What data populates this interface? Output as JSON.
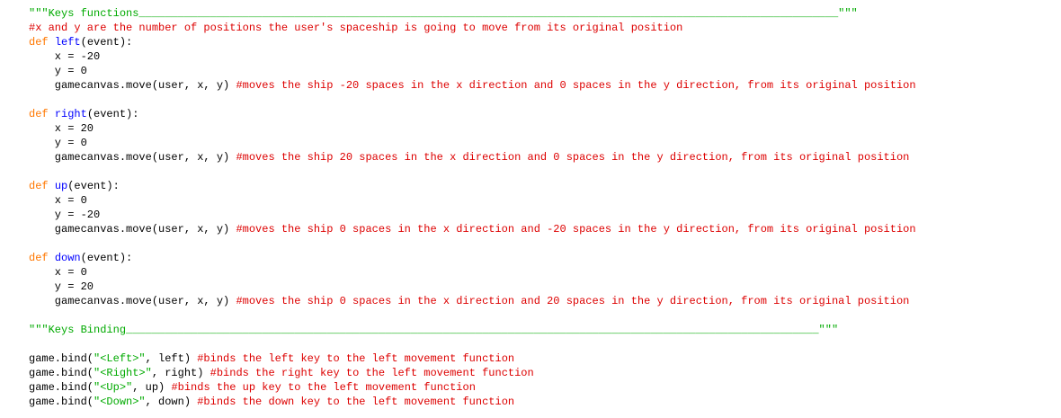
{
  "colors": {
    "background": "#ffffff",
    "keyword": "#ff7700",
    "function_name": "#0000ff",
    "comment": "#dd0000",
    "string": "#00aa00",
    "default": "#000000"
  },
  "lines": [
    [
      {
        "t": "\"\"\"Keys functions____________________________________________________________________________________________________________\"\"\"",
        "c": "st"
      }
    ],
    [
      {
        "t": "#x and y are the number of positions the user's spaceship is going to move from its original position",
        "c": "cm"
      }
    ],
    [
      {
        "t": "def ",
        "c": "kw"
      },
      {
        "t": "left",
        "c": "fn"
      },
      {
        "t": "(event):",
        "c": ""
      }
    ],
    [
      {
        "t": "    x = -20",
        "c": ""
      }
    ],
    [
      {
        "t": "    y = 0",
        "c": ""
      }
    ],
    [
      {
        "t": "    gamecanvas.move(user, x, y) ",
        "c": ""
      },
      {
        "t": "#moves the ship -20 spaces in the x direction and 0 spaces in the y direction, from its original position",
        "c": "cm"
      }
    ],
    [],
    [
      {
        "t": "def ",
        "c": "kw"
      },
      {
        "t": "right",
        "c": "fn"
      },
      {
        "t": "(event):",
        "c": ""
      }
    ],
    [
      {
        "t": "    x = 20",
        "c": ""
      }
    ],
    [
      {
        "t": "    y = 0",
        "c": ""
      }
    ],
    [
      {
        "t": "    gamecanvas.move(user, x, y) ",
        "c": ""
      },
      {
        "t": "#moves the ship 20 spaces in the x direction and 0 spaces in the y direction, from its original position",
        "c": "cm"
      }
    ],
    [],
    [
      {
        "t": "def ",
        "c": "kw"
      },
      {
        "t": "up",
        "c": "fn"
      },
      {
        "t": "(event):",
        "c": ""
      }
    ],
    [
      {
        "t": "    x = 0",
        "c": ""
      }
    ],
    [
      {
        "t": "    y = -20",
        "c": ""
      }
    ],
    [
      {
        "t": "    gamecanvas.move(user, x, y) ",
        "c": ""
      },
      {
        "t": "#moves the ship 0 spaces in the x direction and -20 spaces in the y direction, from its original position",
        "c": "cm"
      }
    ],
    [],
    [
      {
        "t": "def ",
        "c": "kw"
      },
      {
        "t": "down",
        "c": "fn"
      },
      {
        "t": "(event):",
        "c": ""
      }
    ],
    [
      {
        "t": "    x = 0",
        "c": ""
      }
    ],
    [
      {
        "t": "    y = 20",
        "c": ""
      }
    ],
    [
      {
        "t": "    gamecanvas.move(user, x, y) ",
        "c": ""
      },
      {
        "t": "#moves the ship 0 spaces in the x direction and 20 spaces in the y direction, from its original position",
        "c": "cm"
      }
    ],
    [],
    [
      {
        "t": "\"\"\"Keys Binding___________________________________________________________________________________________________________\"\"\"",
        "c": "st"
      }
    ],
    [],
    [
      {
        "t": "game.bind(",
        "c": ""
      },
      {
        "t": "\"<Left>\"",
        "c": "st"
      },
      {
        "t": ", left) ",
        "c": ""
      },
      {
        "t": "#binds the left key to the left movement function",
        "c": "cm"
      }
    ],
    [
      {
        "t": "game.bind(",
        "c": ""
      },
      {
        "t": "\"<Right>\"",
        "c": "st"
      },
      {
        "t": ", right) ",
        "c": ""
      },
      {
        "t": "#binds the right key to the left movement function",
        "c": "cm"
      }
    ],
    [
      {
        "t": "game.bind(",
        "c": ""
      },
      {
        "t": "\"<Up>\"",
        "c": "st"
      },
      {
        "t": ", up) ",
        "c": ""
      },
      {
        "t": "#binds the up key to the left movement function",
        "c": "cm"
      }
    ],
    [
      {
        "t": "game.bind(",
        "c": ""
      },
      {
        "t": "\"<Down>\"",
        "c": "st"
      },
      {
        "t": ", down) ",
        "c": ""
      },
      {
        "t": "#binds the down key to the left movement function",
        "c": "cm"
      }
    ]
  ]
}
